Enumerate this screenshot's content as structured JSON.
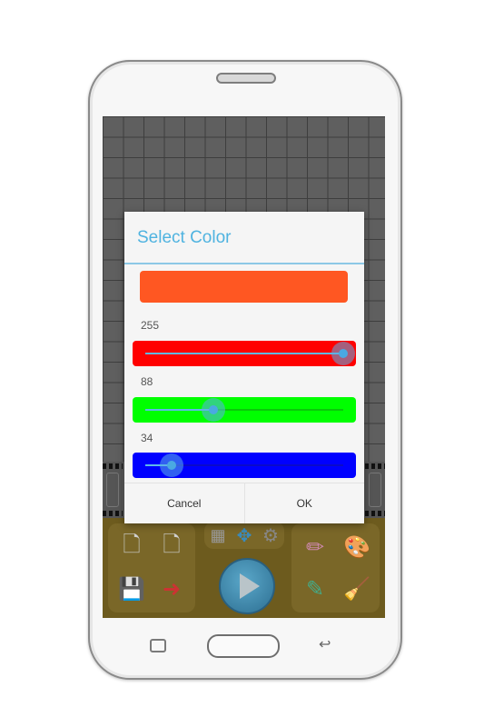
{
  "dialog": {
    "title": "Select Color",
    "preview_color": "#ff5722",
    "sliders": [
      {
        "channel": "red",
        "value": "255",
        "max": 255,
        "color": "#ff0000"
      },
      {
        "channel": "green",
        "value": "88",
        "max": 255,
        "color": "#00ff00"
      },
      {
        "channel": "blue",
        "value": "34",
        "max": 255,
        "color": "#0000ff"
      }
    ],
    "cancel_label": "Cancel",
    "ok_label": "OK"
  },
  "toolbar": {
    "left_tools": [
      "new-file-icon",
      "delete-file-icon",
      "save-icon",
      "export-file-icon"
    ],
    "mid_tools": [
      "grid-icon",
      "move-arrows-icon",
      "settings-gear-icon"
    ],
    "play": "play-icon",
    "right_tools": [
      "color-pencils-icon",
      "paint-bucket-icon",
      "pencil-icon",
      "broom-icon"
    ]
  },
  "device": {
    "nav": [
      "recent-apps-icon",
      "home-button",
      "back-icon"
    ]
  },
  "glyphs": {
    "new_file": "🗋",
    "delete_file": "🗋",
    "save": "💾",
    "export": "➜",
    "grid": "▦",
    "move": "✥",
    "gear": "⚙",
    "pencils": "✏",
    "bucket": "🎨",
    "pencil": "✎",
    "broom": "🧹",
    "back": "↩"
  }
}
